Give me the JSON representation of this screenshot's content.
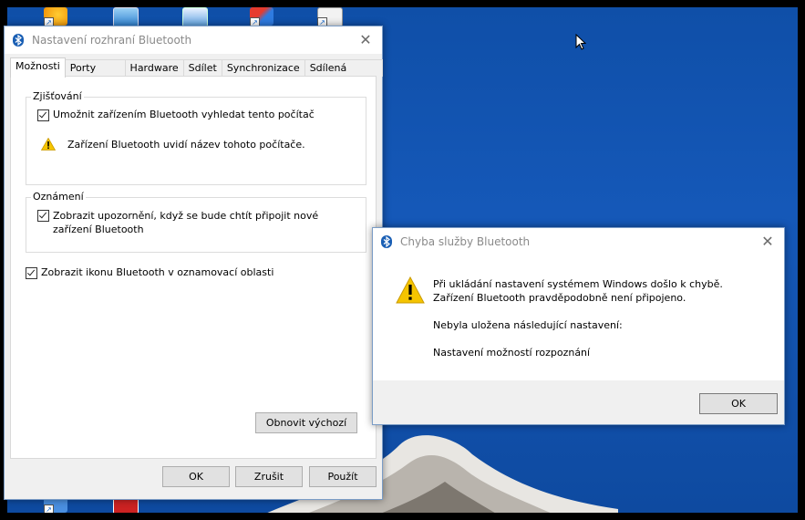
{
  "main_window": {
    "title": "Nastavení rozhraní Bluetooth",
    "tabs": [
      {
        "label": "Možnosti"
      },
      {
        "label": "Porty COM"
      },
      {
        "label": "Hardware"
      },
      {
        "label": "Sdílet"
      },
      {
        "label": "Synchronizace"
      },
      {
        "label": "Sdílená složka"
      }
    ],
    "discovery": {
      "label": "Zjišťování",
      "checkbox_label": "Umožnit zařízením Bluetooth vyhledat tento počítač",
      "checked": true,
      "warning": "Zařízení Bluetooth uvidí název tohoto počítače."
    },
    "notifications": {
      "label": "Oznámení",
      "checkbox_label": "Zobrazit upozornění, když se bude chtít připojit nové zařízení Bluetooth",
      "checked": true
    },
    "tray_icon": {
      "checkbox_label": "Zobrazit ikonu Bluetooth v oznamovací oblasti",
      "checked": true
    },
    "restore_button": "Obnovit výchozí",
    "ok_button": "OK",
    "cancel_button": "Zrušit",
    "apply_button": "Použít"
  },
  "error_dialog": {
    "title": "Chyba služby Bluetooth",
    "message_line1": "Při ukládání nastavení systémem Windows došlo k chybě. Zařízení Bluetooth pravděpodobně není připojeno.",
    "message_line2": "Nebyla uložena následující nastavení:",
    "message_line3": "Nastavení možností rozpoznání",
    "ok_button": "OK"
  },
  "colors": {
    "desktop": "#1558b8",
    "bluetooth": "#1a5fb4",
    "warning": "#f5c400"
  }
}
